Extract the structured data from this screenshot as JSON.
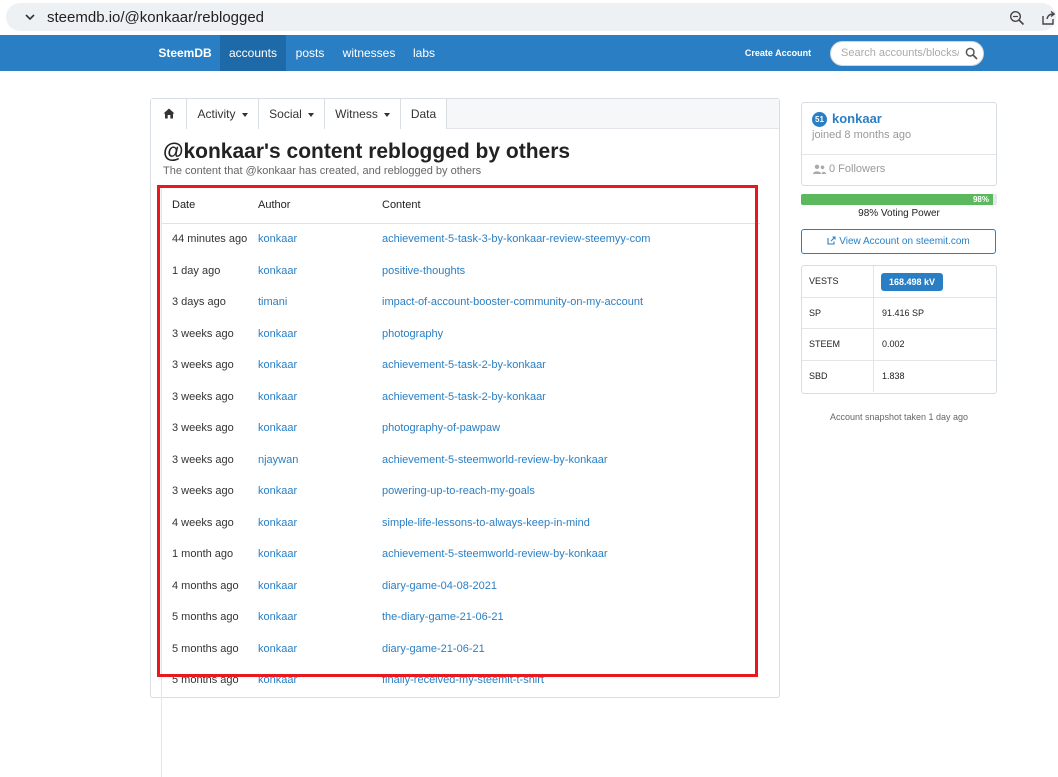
{
  "browser": {
    "url": "steemdb.io/@konkaar/reblogged"
  },
  "nav": {
    "brand": "SteemDB",
    "items": [
      "accounts",
      "posts",
      "witnesses",
      "labs"
    ],
    "create_account": "Create Account",
    "search_placeholder": "Search accounts/blocks/t"
  },
  "tabs": {
    "activity": "Activity",
    "social": "Social",
    "witness": "Witness",
    "data": "Data"
  },
  "page": {
    "title": "@konkaar's content reblogged by others",
    "subtitle": "The content that @konkaar has created, and reblogged by others"
  },
  "table": {
    "headers": {
      "date": "Date",
      "author": "Author",
      "content": "Content"
    },
    "rows": [
      {
        "date": "44 minutes ago",
        "author": "konkaar",
        "content": "achievement-5-task-3-by-konkaar-review-steemyy-com"
      },
      {
        "date": "1 day ago",
        "author": "konkaar",
        "content": "positive-thoughts"
      },
      {
        "date": "3 days ago",
        "author": "timani",
        "content": "impact-of-account-booster-community-on-my-account"
      },
      {
        "date": "3 weeks ago",
        "author": "konkaar",
        "content": "photography"
      },
      {
        "date": "3 weeks ago",
        "author": "konkaar",
        "content": "achievement-5-task-2-by-konkaar"
      },
      {
        "date": "3 weeks ago",
        "author": "konkaar",
        "content": "achievement-5-task-2-by-konkaar"
      },
      {
        "date": "3 weeks ago",
        "author": "konkaar",
        "content": "photography-of-pawpaw"
      },
      {
        "date": "3 weeks ago",
        "author": "njaywan",
        "content": "achievement-5-steemworld-review-by-konkaar"
      },
      {
        "date": "3 weeks ago",
        "author": "konkaar",
        "content": "powering-up-to-reach-my-goals"
      },
      {
        "date": "4 weeks ago",
        "author": "konkaar",
        "content": "simple-life-lessons-to-always-keep-in-mind"
      },
      {
        "date": "1 month ago",
        "author": "konkaar",
        "content": "achievement-5-steemworld-review-by-konkaar"
      },
      {
        "date": "4 months ago",
        "author": "konkaar",
        "content": "diary-game-04-08-2021"
      },
      {
        "date": "5 months ago",
        "author": "konkaar",
        "content": "the-diary-game-21-06-21"
      },
      {
        "date": "5 months ago",
        "author": "konkaar",
        "content": "diary-game-21-06-21"
      },
      {
        "date": "5 months ago",
        "author": "konkaar",
        "content": "finally-received-my-steemit-t-shirt"
      }
    ]
  },
  "profile": {
    "reputation": "51",
    "name": "konkaar",
    "joined": "joined 8 months ago",
    "followers": "0 Followers"
  },
  "voting_power": {
    "percent": 98,
    "percent_label": "98%",
    "label": "98% Voting Power"
  },
  "view_account_label": "View Account on steemit.com",
  "balances": [
    {
      "key": "VESTS",
      "value": "168.498 kV"
    },
    {
      "key": "SP",
      "value": "91.416 SP"
    },
    {
      "key": "STEEM",
      "value": "0.002"
    },
    {
      "key": "SBD",
      "value": "1.838"
    }
  ],
  "snapshot": "Account snapshot taken 1 day ago",
  "colors": {
    "brand_blue": "#2a7fc4",
    "voting_green": "#5cb85c",
    "highlight_red": "#e8181e"
  }
}
